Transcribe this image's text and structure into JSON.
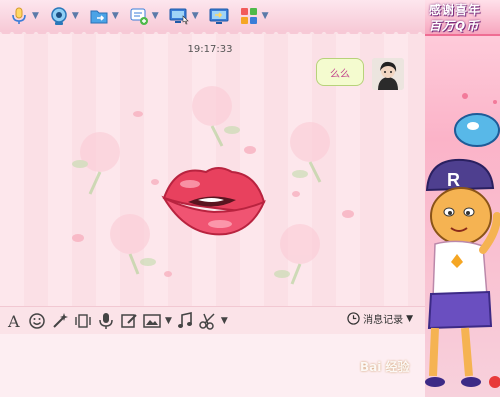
{
  "toolbar": {
    "items": [
      {
        "icon": "microphone-icon"
      },
      {
        "icon": "video-camera-icon"
      },
      {
        "icon": "send-file-icon"
      },
      {
        "icon": "new-message-icon"
      },
      {
        "icon": "remote-desktop-icon"
      },
      {
        "icon": "screen-share-icon"
      },
      {
        "icon": "apps-icon"
      }
    ]
  },
  "banner": {
    "line1": "感谢喜年",
    "line2": "百万Q币"
  },
  "chat": {
    "timestamp": "19:17:33",
    "message": "么么"
  },
  "input_toolbar": {
    "history_label": "消息记录"
  },
  "watermark": "Bai 经验",
  "colors": {
    "toolbar_icon_blue": "#3b7dd8",
    "lips_red": "#e8415e",
    "bubble_bg": "#f4fbcf"
  }
}
